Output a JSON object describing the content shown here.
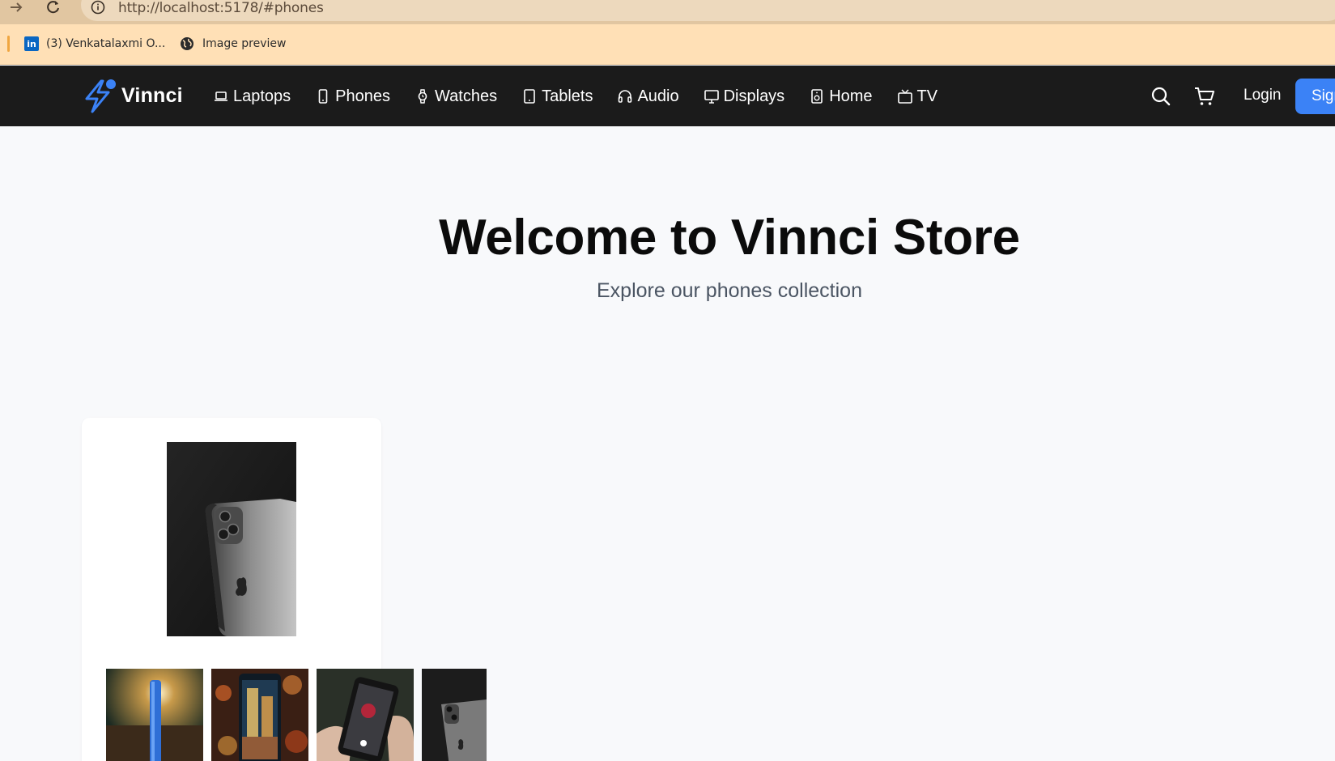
{
  "browser": {
    "url": "http://localhost:5178/#phones",
    "bookmarks": [
      {
        "label": "(3) Venkatalaxmi O...",
        "icon": "linkedin-icon"
      },
      {
        "label": "Image preview",
        "icon": "globe-icon"
      }
    ]
  },
  "navbar": {
    "brand": "Vinnci",
    "links": [
      {
        "label": "Laptops",
        "icon": "laptop-icon"
      },
      {
        "label": "Phones",
        "icon": "phone-icon"
      },
      {
        "label": "Watches",
        "icon": "watch-icon"
      },
      {
        "label": "Tablets",
        "icon": "tablet-icon"
      },
      {
        "label": "Audio",
        "icon": "headphones-icon"
      },
      {
        "label": "Displays",
        "icon": "monitor-icon"
      },
      {
        "label": "Home",
        "icon": "speaker-icon"
      },
      {
        "label": "TV",
        "icon": "tv-icon"
      }
    ],
    "login_label": "Login",
    "signup_label": "Sign",
    "accent_color": "#3b82f6"
  },
  "hero": {
    "title": "Welcome to Vinnci Store",
    "subtitle": "Explore our phones collection"
  },
  "product_card": {
    "main_image": "dark-phone-back-photo",
    "thumbnails": [
      "blue-phone-photo",
      "city-night-phone-photo",
      "hand-holding-phone-photo",
      "dark-phone-back-photo"
    ]
  }
}
